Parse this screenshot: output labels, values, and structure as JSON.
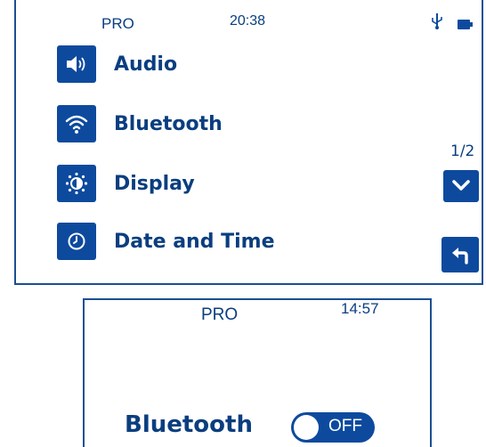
{
  "colors": {
    "accent": "#0d4a9e",
    "text": "#0a3e7f",
    "frame": "#1a4f93"
  },
  "screen1": {
    "status": {
      "brand": "PRO",
      "time": "20:38",
      "usb_icon": "usb-icon",
      "battery_icon": "battery-icon"
    },
    "menu": [
      {
        "label": "Audio",
        "icon": "speaker-icon"
      },
      {
        "label": "Bluetooth",
        "icon": "wireless-icon"
      },
      {
        "label": "Display",
        "icon": "brightness-icon"
      },
      {
        "label": "Date and Time",
        "icon": "clock-icon"
      }
    ],
    "page_indicator": "1/2",
    "down_button_icon": "chevron-down-icon",
    "back_button_icon": "back-arrow-icon"
  },
  "screen2": {
    "status": {
      "brand": "PRO",
      "time": "14:57"
    },
    "setting_label": "Bluetooth",
    "toggle": {
      "state_text": "OFF",
      "on": false
    }
  }
}
